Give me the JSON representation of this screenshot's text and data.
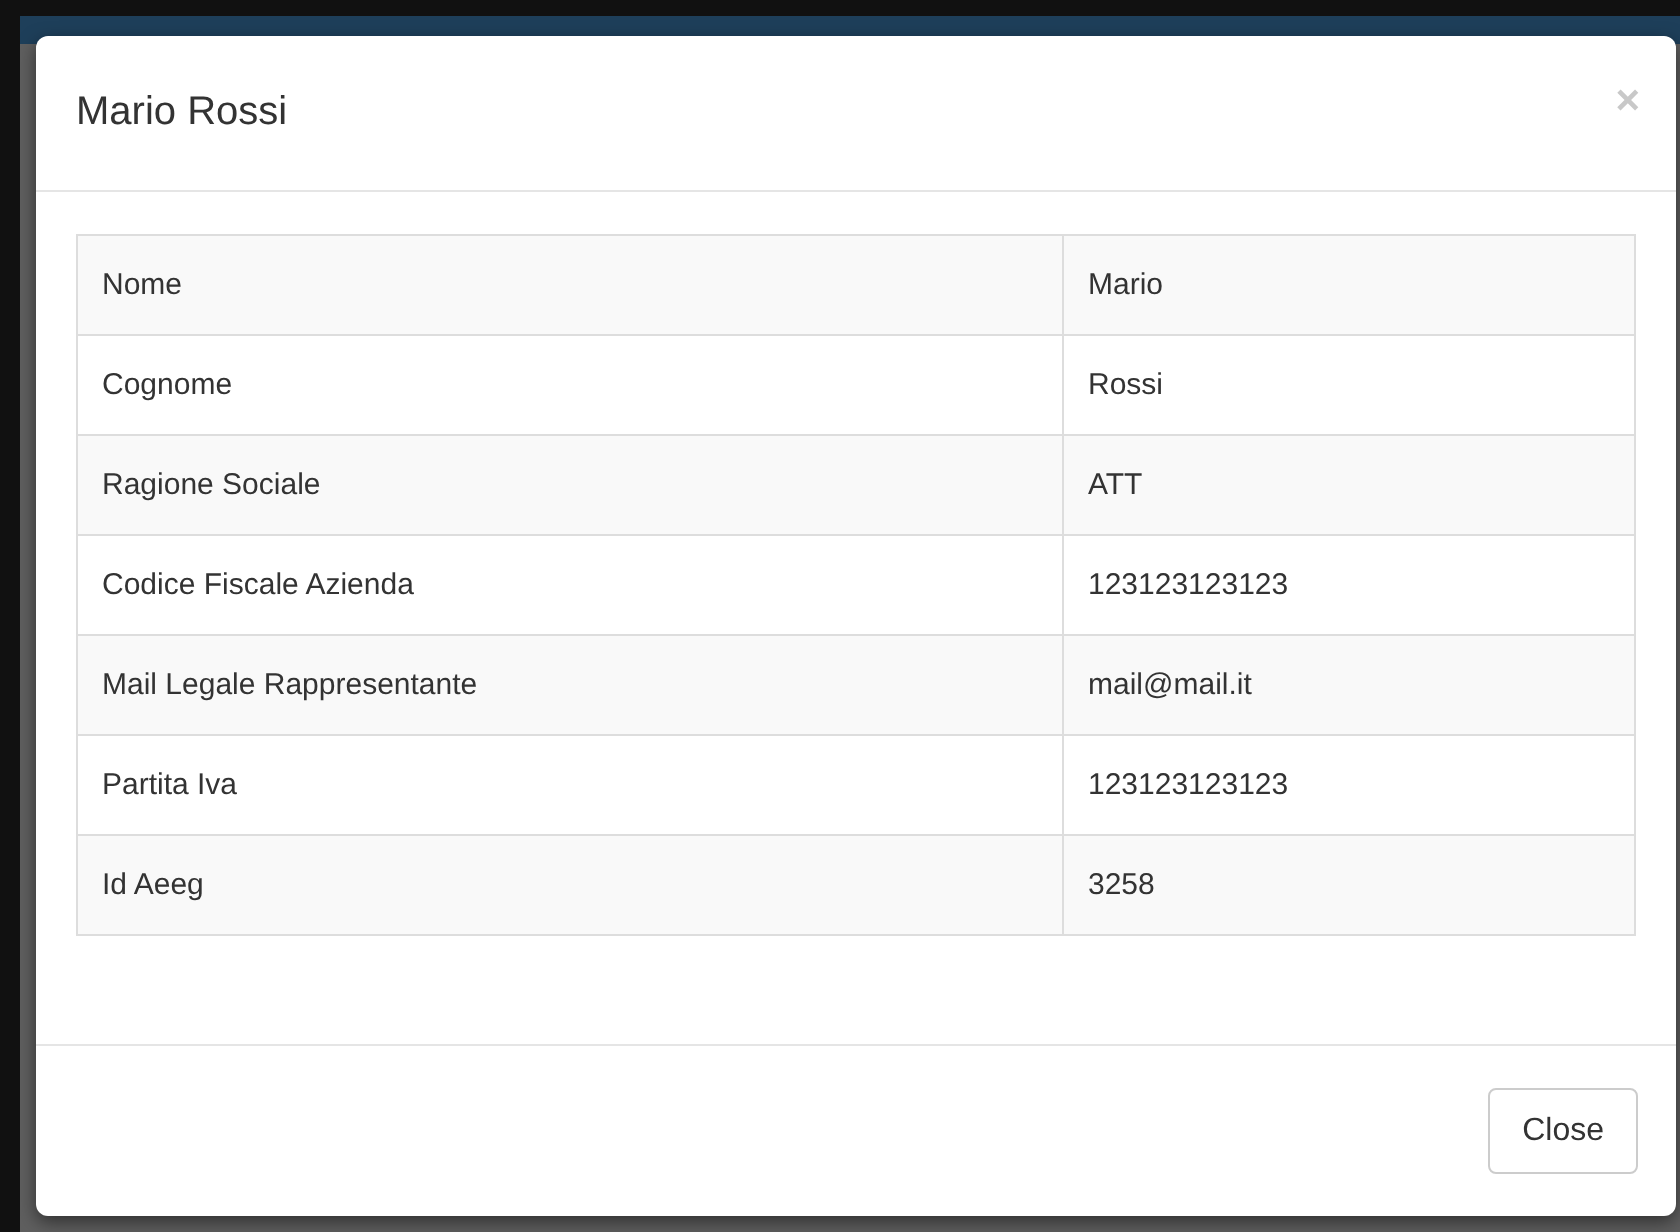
{
  "modal": {
    "title": "Mario Rossi",
    "close_icon": "×",
    "rows": [
      {
        "label": "Nome",
        "value": "Mario"
      },
      {
        "label": "Cognome",
        "value": "Rossi"
      },
      {
        "label": "Ragione Sociale",
        "value": "ATT"
      },
      {
        "label": "Codice Fiscale Azienda",
        "value": "123123123123"
      },
      {
        "label": "Mail Legale Rappresentante",
        "value": "mail@mail.it"
      },
      {
        "label": "Partita Iva",
        "value": "123123123123"
      },
      {
        "label": "Id Aeeg",
        "value": "3258"
      }
    ],
    "buttons": [
      "Close"
    ]
  }
}
